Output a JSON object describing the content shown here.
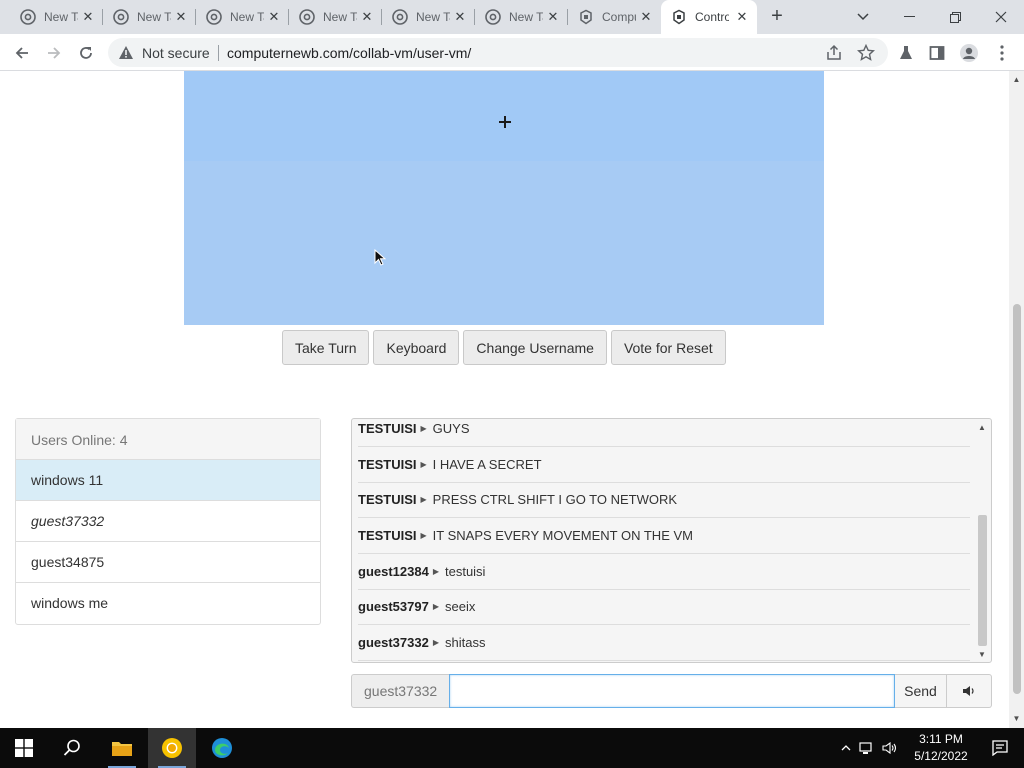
{
  "browser": {
    "tabs": [
      {
        "label": "New Tab",
        "active": false
      },
      {
        "label": "New Tab",
        "active": false
      },
      {
        "label": "New Tab",
        "active": false
      },
      {
        "label": "New Tab",
        "active": false
      },
      {
        "label": "New Tab",
        "active": false
      },
      {
        "label": "New Tab",
        "active": false
      },
      {
        "label": "Computernewb",
        "active": false
      },
      {
        "label": "Control",
        "active": true
      }
    ],
    "security_label": "Not secure",
    "url": "computernewb.com/collab-vm/user-vm/"
  },
  "vm": {
    "buttons": [
      "Take Turn",
      "Keyboard",
      "Change Username",
      "Vote for Reset"
    ],
    "screen_color": "#a1c9f6"
  },
  "users": {
    "header": "Users Online: 4",
    "list": [
      {
        "name": "windows 11",
        "highlight": true
      },
      {
        "name": "guest37332",
        "me": true
      },
      {
        "name": "guest34875"
      },
      {
        "name": "windows me"
      }
    ]
  },
  "chat": {
    "messages": [
      {
        "user": "TESTUISI",
        "text": "GUYS"
      },
      {
        "user": "TESTUISI",
        "text": "I HAVE A SECRET"
      },
      {
        "user": "TESTUISI",
        "text": "PRESS CTRL SHIFT I GO TO NETWORK"
      },
      {
        "user": "TESTUISI",
        "text": "IT SNAPS EVERY MOVEMENT ON THE VM"
      },
      {
        "user": "guest12384",
        "text": "testuisi"
      },
      {
        "user": "guest53797",
        "text": "seeix"
      },
      {
        "user": "guest37332",
        "text": "shitass"
      }
    ],
    "username": "guest37332",
    "input_value": "",
    "send_label": "Send"
  },
  "taskbar": {
    "time": "3:11 PM",
    "date": "5/12/2022"
  }
}
